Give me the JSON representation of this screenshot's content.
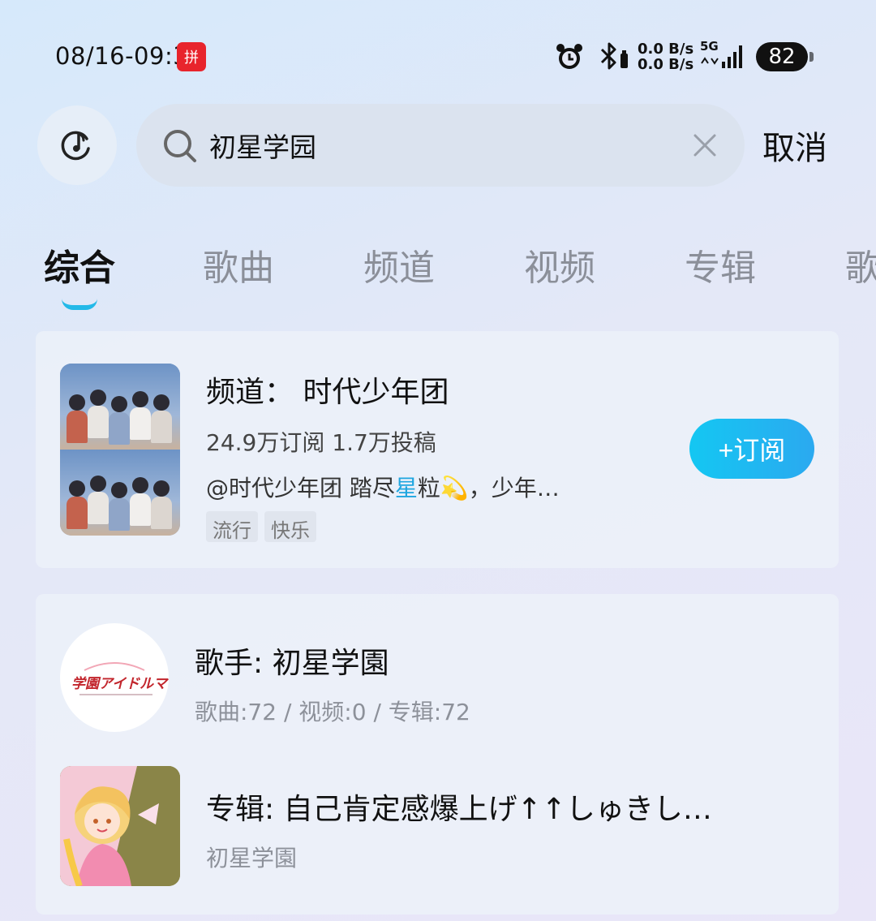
{
  "status_bar": {
    "time": "08/16-09:32",
    "app_badge": "拼",
    "net_speed_up": "0.0 B/s",
    "net_speed_down": "0.0 B/s",
    "network": "5G",
    "battery": "82"
  },
  "search": {
    "query": "初星学园",
    "cancel_label": "取消"
  },
  "tabs": [
    {
      "label": "综合",
      "active": true
    },
    {
      "label": "歌曲",
      "active": false
    },
    {
      "label": "频道",
      "active": false
    },
    {
      "label": "视频",
      "active": false
    },
    {
      "label": "专辑",
      "active": false
    },
    {
      "label": "歌",
      "active": false
    }
  ],
  "channel_card": {
    "title": "频道：  时代少年团",
    "subscribers": "24.9万订阅",
    "posts": "1.7万投稿",
    "desc_prefix": "@时代少年团 踏尽",
    "desc_highlight": "星",
    "desc_suffix": "粒💫，少年…",
    "tags": [
      "流行",
      "快乐"
    ],
    "subscribe_label": "+订阅"
  },
  "singer_card": {
    "name": "歌手: 初星学園",
    "stats": "歌曲:72 / 视频:0 / 专辑:72",
    "avatar_logo_text": "学園アイドルマスター"
  },
  "album_card": {
    "name": "专辑: 自己肯定感爆上げ↑↑しゅきし…",
    "artist": "初星学園"
  },
  "colors": {
    "accent": "#1fa6e0",
    "subscribe_gradient_start": "#14c7f2",
    "subscribe_gradient_end": "#2ba9f0",
    "tab_indicator": "#23b9e8"
  }
}
